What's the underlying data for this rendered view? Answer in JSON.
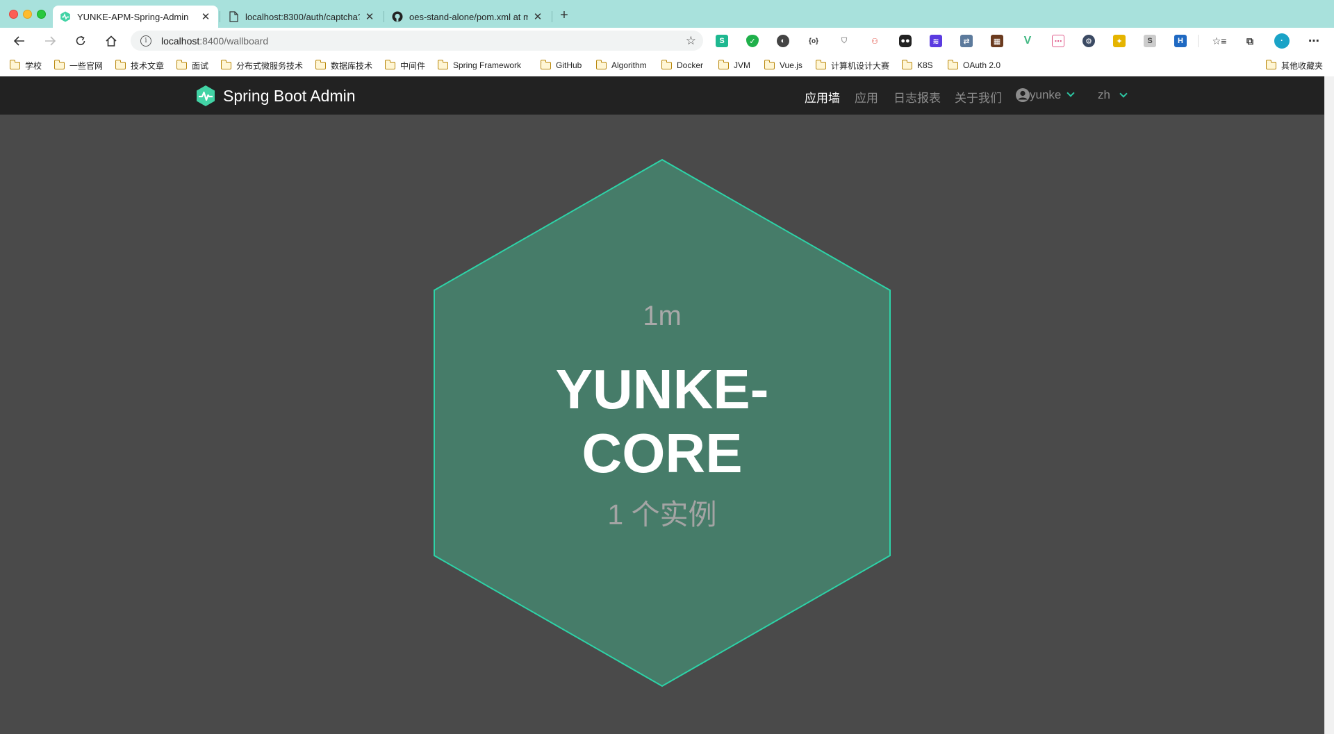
{
  "browser": {
    "tabs": [
      {
        "title": "YUNKE-APM-Spring-Admin",
        "active": true,
        "icon": "spring-admin-icon"
      },
      {
        "title": "localhost:8300/auth/captcha?i",
        "active": false,
        "icon": "page-icon"
      },
      {
        "title": "oes-stand-alone/pom.xml at m",
        "active": false,
        "icon": "github-icon"
      }
    ],
    "url_host": "localhost",
    "url_path": ":8400/wallboard",
    "bookmarks": [
      "学校",
      "一些官网",
      "技术文章",
      "面试",
      "分布式微服务技术",
      "数据库技术",
      "中间件",
      "Spring  Framework",
      "GitHub",
      "Algorithm",
      "Docker",
      "JVM",
      "Vue.js",
      "计算机设计大赛",
      "K8S",
      "OAuth 2.0"
    ],
    "other_bookmarks": "其他收藏夹"
  },
  "app": {
    "brand": "Spring Boot Admin",
    "nav": {
      "wallboard": "应用墙",
      "applications": "应用",
      "journal": "日志报表",
      "about": "关于我们",
      "user": "yunke",
      "language": "zh"
    },
    "colors": {
      "accent": "#42d3a5",
      "hex_fill": "#467c69",
      "hex_border": "#2dd4a8"
    }
  },
  "wallboard": {
    "application": {
      "uptime": "1m",
      "name_line1": "YUNKE-",
      "name_line2": "CORE",
      "instances": "1 个实例"
    }
  }
}
